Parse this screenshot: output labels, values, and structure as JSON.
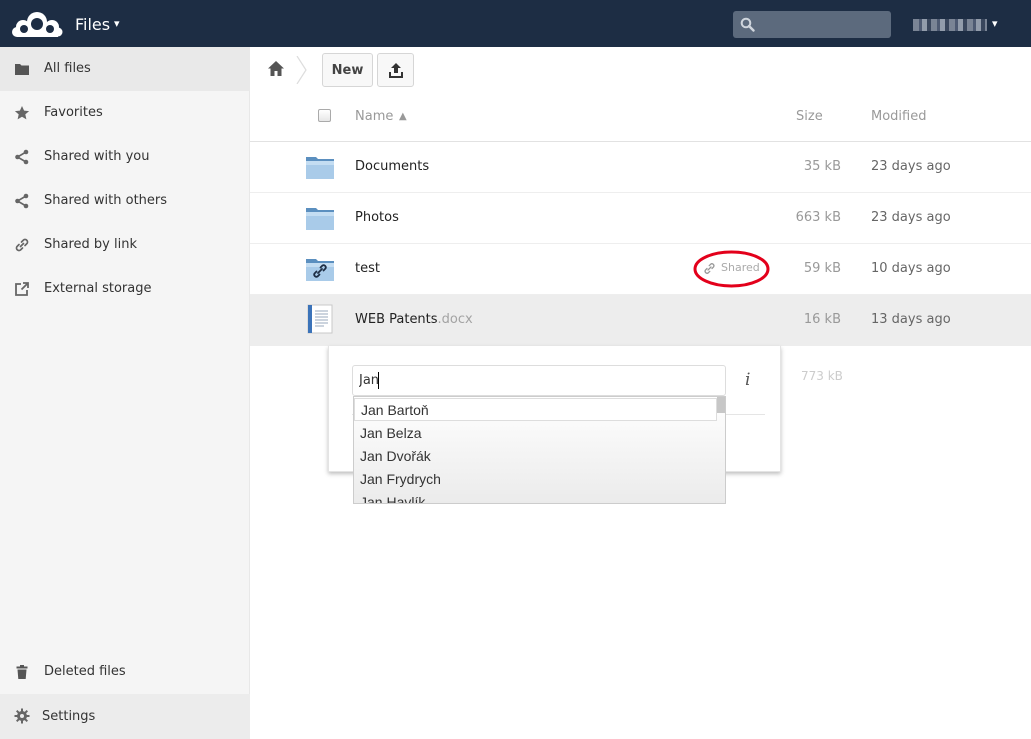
{
  "header": {
    "app_title": "Files",
    "app_caret": "▾",
    "user_caret": "▾",
    "colors": {
      "bar": "#1d2d44"
    }
  },
  "sidebar": {
    "items": [
      {
        "label": "All files",
        "icon": "folder-icon",
        "active": true
      },
      {
        "label": "Favorites",
        "icon": "star-icon"
      },
      {
        "label": "Shared with you",
        "icon": "share-icon"
      },
      {
        "label": "Shared with others",
        "icon": "share-icon"
      },
      {
        "label": "Shared by link",
        "icon": "link-icon"
      },
      {
        "label": "External storage",
        "icon": "external-icon"
      }
    ],
    "deleted": {
      "label": "Deleted files",
      "icon": "trash-icon"
    },
    "settings": {
      "label": "Settings",
      "icon": "gear-icon"
    }
  },
  "controls": {
    "new_label": "New",
    "upload_icon": "upload-icon",
    "home_icon": "home-icon"
  },
  "table": {
    "headers": {
      "name": "Name",
      "sort_arrow": "▲",
      "size": "Size",
      "modified": "Modified"
    },
    "rows": [
      {
        "name": "Documents",
        "ext": "",
        "size": "35 kB",
        "modified": "23 days ago",
        "type": "folder"
      },
      {
        "name": "Photos",
        "ext": "",
        "size": "663 kB",
        "modified": "23 days ago",
        "type": "folder"
      },
      {
        "name": "test",
        "ext": "",
        "size": "59 kB",
        "modified": "10 days ago",
        "type": "shared-folder",
        "badge": "Shared"
      },
      {
        "name": "WEB Patents",
        "ext": ".docx",
        "size": "16 kB",
        "modified": "13 days ago",
        "type": "document"
      }
    ],
    "total_size": "773 kB"
  },
  "share_dropdown": {
    "input_value": "Jan",
    "info_glyph": "i",
    "suggestions": [
      "Jan Bartoň",
      "Jan Belza",
      "Jan Dvořák",
      "Jan Frydrych",
      "Jan Havlík"
    ]
  }
}
